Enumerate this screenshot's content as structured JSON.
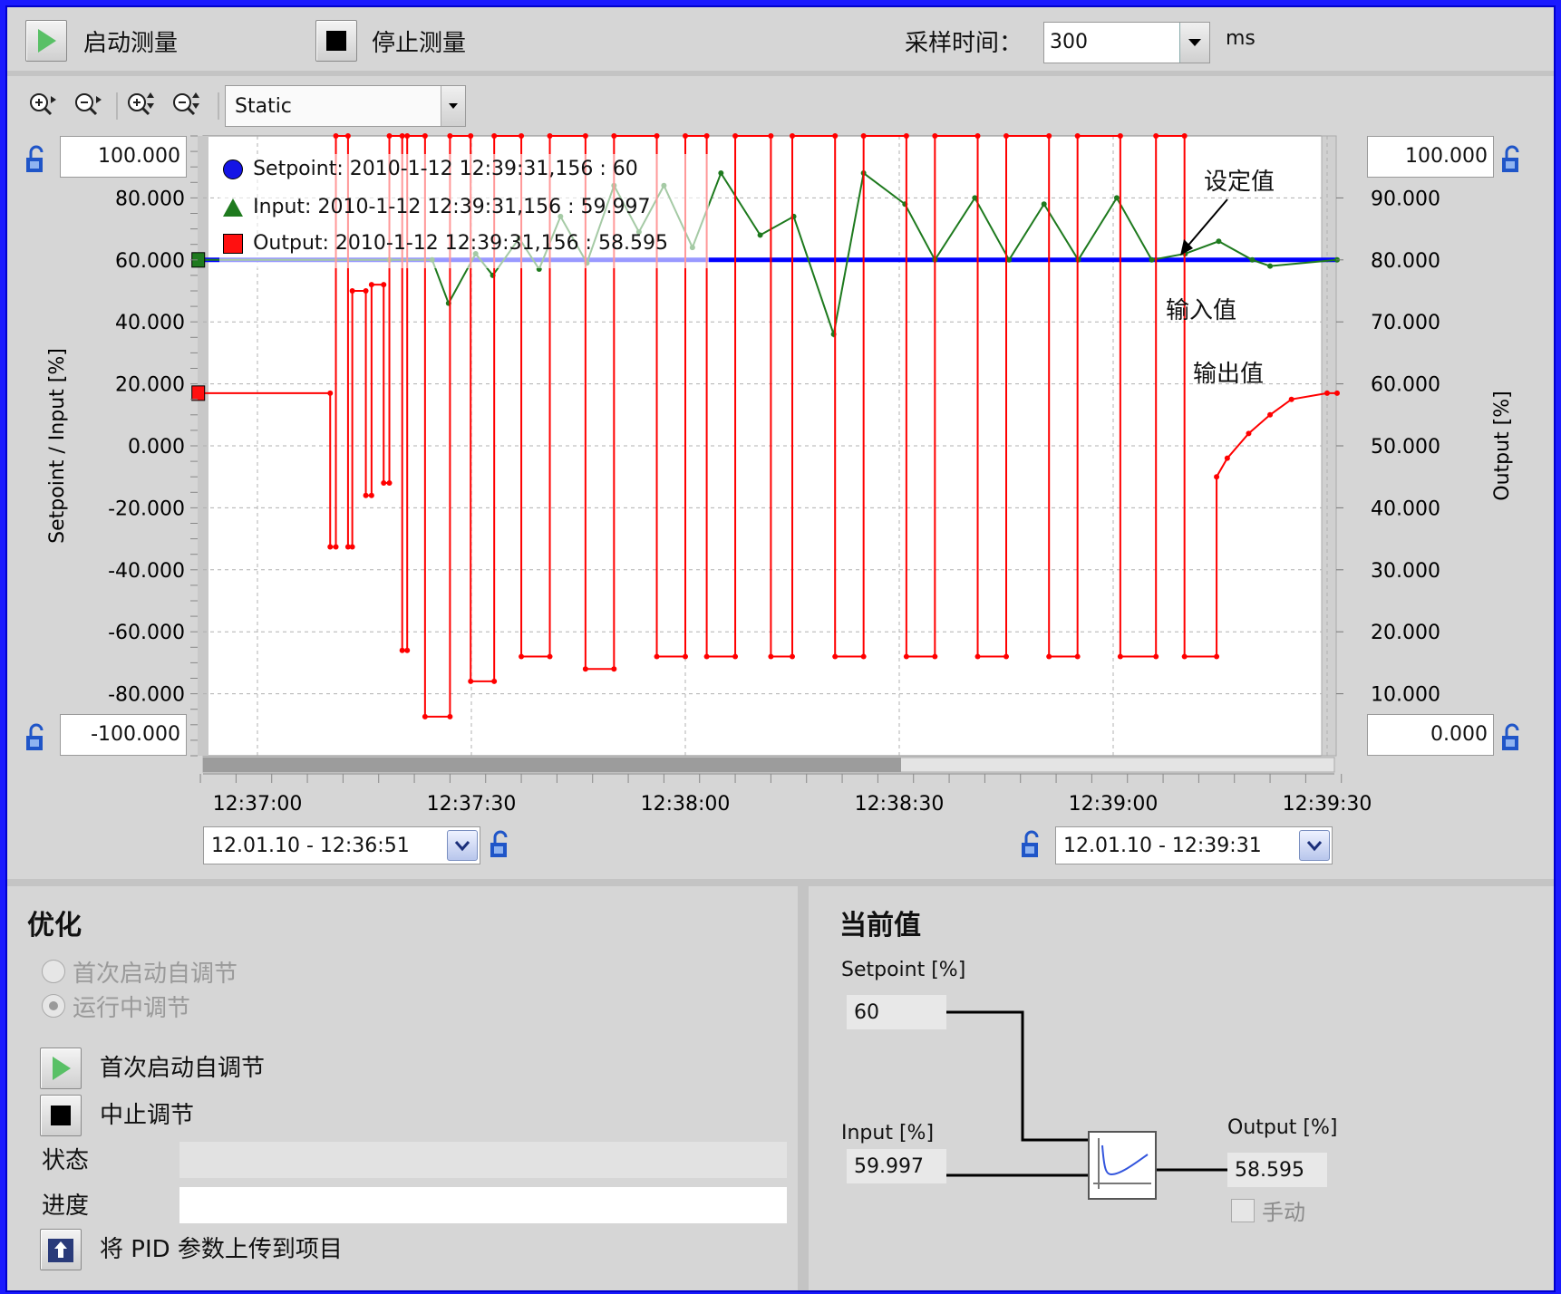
{
  "toolbar": {
    "start_label": "启动测量",
    "stop_label": "停止测量",
    "sample_time_label": "采样时间：",
    "sample_time_value": "300",
    "sample_time_unit": "ms"
  },
  "chart_toolbar": {
    "mode_value": "Static"
  },
  "limits": {
    "left_top": "100.000",
    "left_bottom": "-100.000",
    "right_top": "100.000",
    "right_bottom": "0.000"
  },
  "time_range": {
    "start": "12.01.10 - 12:36:51",
    "end": "12.01.10 - 12:39:31"
  },
  "legend": {
    "setpoint": "Setpoint:   2010-1-12 12:39:31,156 : 60",
    "input": "Input:   2010-1-12 12:39:31,156 : 59.997",
    "output": "Output:   2010-1-12 12:39:31,156 : 58.595"
  },
  "annotations": {
    "setpoint": "设定值",
    "input": "输入值",
    "output": "输出值"
  },
  "colors": {
    "setpoint": "#0000ff",
    "input": "#1e7a1e",
    "output": "#ff0000"
  },
  "chart_data": {
    "type": "line",
    "x_ticks": [
      "12:37:00",
      "12:37:30",
      "12:38:00",
      "12:38:30",
      "12:39:00",
      "12:39:30"
    ],
    "left_axis": {
      "label": "Setpoint / Input  [%]",
      "ticks": [
        "80.000",
        "60.000",
        "40.000",
        "20.000",
        "0.000",
        "-20.000",
        "-40.000",
        "-60.000",
        "-80.000"
      ],
      "ylim": [
        -100,
        100
      ]
    },
    "right_axis": {
      "label": "Output  [%]",
      "ticks": [
        "90.000",
        "80.000",
        "70.000",
        "60.000",
        "50.000",
        "40.000",
        "30.000",
        "20.000",
        "10.000"
      ],
      "ylim": [
        0,
        100
      ]
    },
    "series": [
      {
        "name": "Setpoint",
        "axis": "left",
        "x": [
          -8.3,
          151.4
        ],
        "y": [
          60,
          60
        ]
      },
      {
        "name": "Input",
        "axis": "left",
        "x": [
          -8.3,
          18.5,
          24.5,
          26.8,
          30.6,
          33.0,
          36.7,
          39.5,
          42.5,
          46.2,
          50.0,
          53.5,
          57.0,
          61.0,
          65.0,
          70.5,
          75.2,
          80.8,
          85.0,
          90.8,
          95.0,
          100.6,
          105.4,
          110.3,
          115.1,
          120.5,
          125.4,
          130.1,
          134.8,
          139.5,
          142.0,
          151.4
        ],
        "y": [
          60,
          60,
          60,
          46,
          62,
          55,
          67,
          57,
          74,
          59,
          84,
          69,
          84,
          64,
          88,
          68,
          74,
          36,
          88,
          78,
          60,
          80,
          60,
          78,
          60,
          80,
          60,
          62,
          66,
          60,
          58,
          60
        ]
      },
      {
        "name": "Output",
        "axis": "right",
        "x": [
          -8.3,
          10.2,
          10.2,
          11.0,
          11.0,
          12.7,
          12.7,
          13.3,
          13.3,
          15.2,
          15.2,
          16.0,
          16.0,
          17.7,
          17.7,
          18.5,
          18.5,
          20.3,
          20.3,
          21.0,
          21.0,
          23.5,
          23.5,
          27.0,
          27.0,
          29.9,
          29.9,
          33.2,
          33.2,
          37.0,
          37.0,
          41.0,
          41.0,
          46.0,
          46.0,
          50.0,
          50.0,
          56.0,
          56.0,
          60.0,
          60.0,
          63.0,
          63.0,
          67.0,
          67.0,
          72.0,
          72.0,
          75.0,
          75.0,
          81.0,
          81.0,
          85.0,
          85.0,
          91.0,
          91.0,
          95.0,
          95.0,
          101.0,
          101.0,
          105.0,
          105.0,
          111.0,
          111.0,
          115.0,
          115.0,
          121.0,
          121.0,
          126.0,
          126.0,
          130.0,
          130.0,
          134.5,
          134.5,
          136.0,
          139.0,
          142.0,
          145.0,
          150.0,
          151.4
        ],
        "y": [
          58.5,
          58.5,
          33.7,
          33.7,
          100,
          100,
          33.7,
          33.7,
          75,
          75,
          42,
          42,
          76,
          76,
          44,
          44,
          100,
          100,
          17,
          17,
          100,
          100,
          6.3,
          6.3,
          100,
          100,
          12,
          12,
          100,
          100,
          16,
          16,
          100,
          100,
          14,
          14,
          100,
          100,
          16,
          16,
          100,
          100,
          16,
          16,
          100,
          100,
          16,
          16,
          100,
          100,
          16,
          16,
          100,
          100,
          16,
          16,
          100,
          100,
          16,
          16,
          100,
          100,
          16,
          16,
          100,
          100,
          16,
          16,
          100,
          100,
          16,
          16,
          45,
          48,
          52,
          55,
          57.5,
          58.5,
          58.5
        ]
      }
    ]
  },
  "optimization": {
    "title": "优化",
    "radio_first": "首次启动自调节",
    "radio_running": "运行中调节",
    "start_tuning_label": "首次启动自调节",
    "stop_tuning_label": "中止调节",
    "status_label": "状态",
    "progress_label": "进度",
    "upload_label": "将 PID 参数上传到项目"
  },
  "current_values": {
    "title": "当前值",
    "setpoint_label": "Setpoint [%]",
    "setpoint_value": "60",
    "input_label": "Input [%]",
    "input_value": "59.997",
    "output_label": "Output [%]",
    "output_value": "58.595",
    "manual_label": "手动"
  }
}
